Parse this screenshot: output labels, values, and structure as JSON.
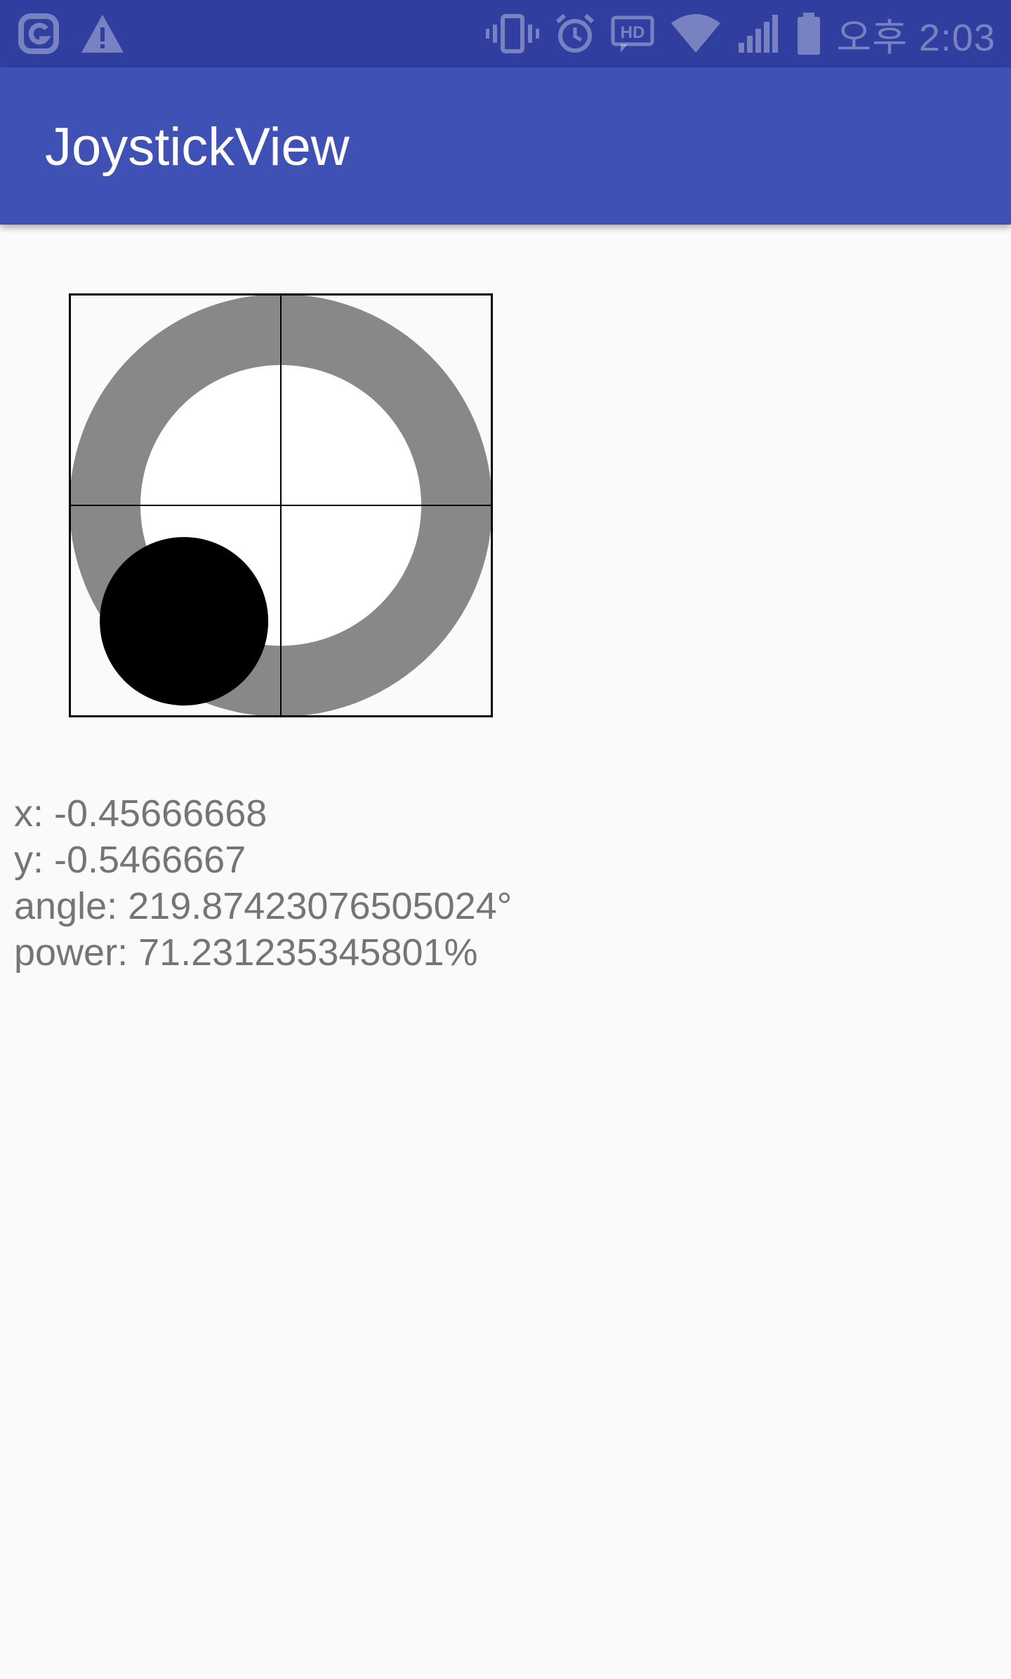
{
  "status_bar": {
    "time": "오후 2:03",
    "icons_left": [
      "notification-app-icon",
      "warning-icon"
    ],
    "icons_right": [
      "vibrate-icon",
      "alarm-icon",
      "hd-voice-icon",
      "wifi-icon",
      "signal-icon",
      "battery-icon"
    ]
  },
  "app_bar": {
    "title": "JoystickView",
    "color": "#3f51b5",
    "status_color": "#303f9f"
  },
  "joystick": {
    "x": -0.45666668,
    "y": -0.5466667,
    "ring_color": "#888888",
    "inner_color": "#ffffff",
    "knob_color": "#000000"
  },
  "readout": {
    "x_text": "x: -0.45666668",
    "y_text": "y: -0.5466667",
    "angle_text": "angle: 219.87423076505024°",
    "power_text": "power: 71.231235345801%"
  }
}
